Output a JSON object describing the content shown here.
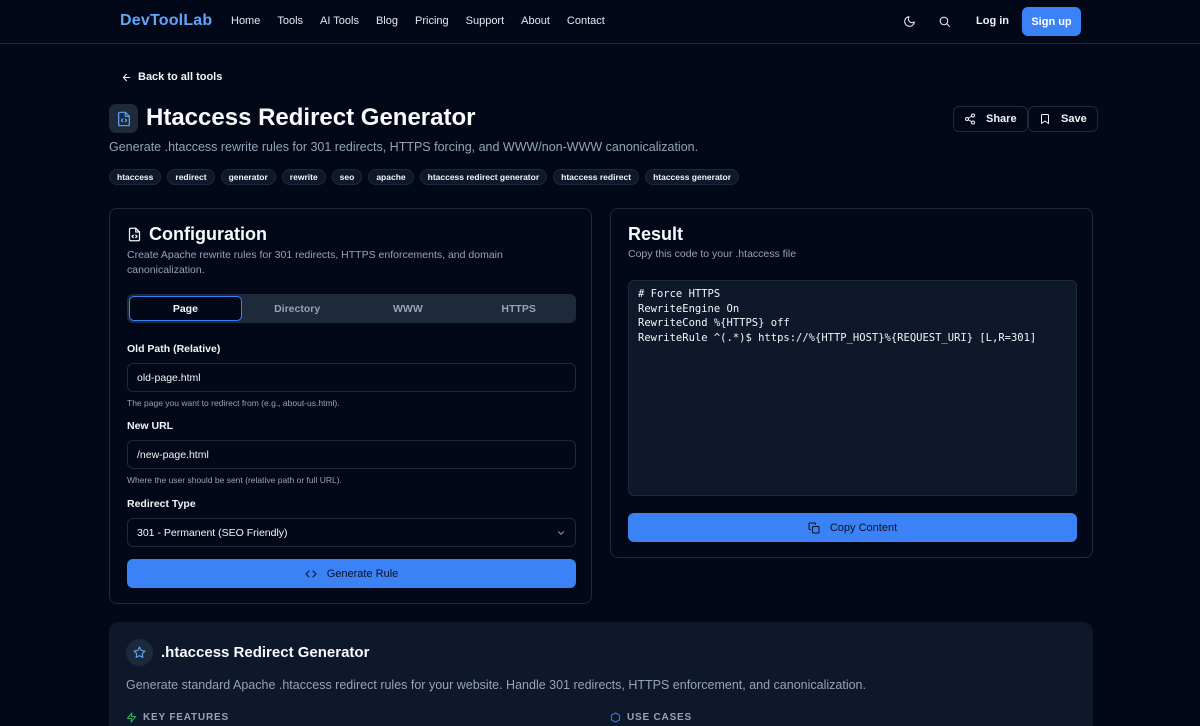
{
  "nav": {
    "logo": "DevToolLab",
    "links": [
      "Home",
      "Tools",
      "AI Tools",
      "Blog",
      "Pricing",
      "Support",
      "About",
      "Contact"
    ],
    "login": "Log in",
    "signup": "Sign up"
  },
  "header": {
    "back": "Back to all tools",
    "title": "Htaccess Redirect Generator",
    "subtitle": "Generate .htaccess rewrite rules for 301 redirects, HTTPS forcing, and WWW/non-WWW canonicalization.",
    "share": "Share",
    "save": "Save",
    "tags": [
      "htaccess",
      "redirect",
      "generator",
      "rewrite",
      "seo",
      "apache",
      "htaccess redirect generator",
      "htaccess redirect",
      "htaccess generator"
    ]
  },
  "config": {
    "title": "Configuration",
    "description": "Create Apache rewrite rules for 301 redirects, HTTPS enforcements, and domain canonicalization.",
    "tabs": [
      "Page",
      "Directory",
      "WWW",
      "HTTPS"
    ],
    "active_tab": "Page",
    "old_path": {
      "label": "Old Path (Relative)",
      "value": "old-page.html",
      "help": "The page you want to redirect from (e.g., about-us.html)."
    },
    "new_url": {
      "label": "New URL",
      "value": "/new-page.html",
      "help": "Where the user should be sent (relative path or full URL)."
    },
    "redirect_type": {
      "label": "Redirect Type",
      "value": "301 - Permanent (SEO Friendly)"
    },
    "generate": "Generate Rule"
  },
  "result": {
    "title": "Result",
    "description": "Copy this code to your .htaccess file",
    "code": [
      "# Force HTTPS",
      "RewriteEngine On",
      "RewriteCond %{HTTPS} off",
      "RewriteRule ^(.*)$ https://%{HTTP_HOST}%{REQUEST_URI} [L,R=301]"
    ],
    "copy": "Copy Content"
  },
  "info": {
    "title": ".htaccess Redirect Generator",
    "description": "Generate standard Apache .htaccess redirect rules for your website. Handle 301 redirects, HTTPS enforcement, and canonicalization.",
    "features": "KEY FEATURES",
    "use_cases": "USE CASES"
  },
  "colors": {
    "accent": "#3b82f6",
    "logo": "#60a5fa",
    "background": "#020817",
    "panel": "#0f172a",
    "border": "#1e293b",
    "muted": "#94a3b8"
  }
}
